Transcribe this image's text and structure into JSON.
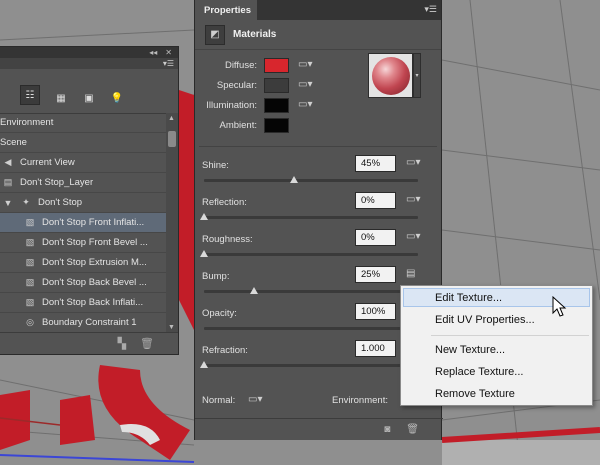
{
  "panel3d": {
    "items": [
      {
        "label": "Environment",
        "icon": "",
        "indent": 2,
        "selected": false
      },
      {
        "label": "Scene",
        "icon": "",
        "indent": 2,
        "selected": false
      },
      {
        "label": "Current View",
        "icon": "camera-icon",
        "indent": 0,
        "selected": false
      },
      {
        "label": "Don't Stop_Layer",
        "icon": "layer-icon",
        "indent": 0,
        "selected": false
      },
      {
        "label": "Don't Stop",
        "icon": "mesh-icon",
        "indent": 0,
        "selected": false
      },
      {
        "label": "Don't Stop Front Inflati...",
        "icon": "material-icon",
        "indent": 1,
        "selected": true
      },
      {
        "label": "Don't Stop Front Bevel ...",
        "icon": "material-icon",
        "indent": 1,
        "selected": false
      },
      {
        "label": "Don't Stop Extrusion M...",
        "icon": "material-icon",
        "indent": 1,
        "selected": false
      },
      {
        "label": "Don't Stop Back Bevel ...",
        "icon": "material-icon",
        "indent": 1,
        "selected": false
      },
      {
        "label": "Don't Stop Back Inflati...",
        "icon": "material-icon",
        "indent": 1,
        "selected": false
      },
      {
        "label": "Boundary Constraint 1",
        "icon": "constraint-icon",
        "indent": 1,
        "selected": false
      }
    ]
  },
  "properties": {
    "tab_label": "Properties",
    "section_title": "Materials",
    "swatches": [
      {
        "label": "Diffuse:",
        "color": "#d8262d"
      },
      {
        "label": "Specular:",
        "color": "#3c3c3c"
      },
      {
        "label": "Illumination:",
        "color": "#050505"
      },
      {
        "label": "Ambient:",
        "color": "#050505"
      }
    ],
    "params": [
      {
        "label": "Shine:",
        "value": "45%",
        "level": 0.45
      },
      {
        "label": "Reflection:",
        "value": "0%",
        "level": 0
      },
      {
        "label": "Roughness:",
        "value": "0%",
        "level": 0
      },
      {
        "label": "Bump:",
        "value": "25%",
        "level": 0.25
      },
      {
        "label": "Opacity:",
        "value": "100%",
        "level": 1
      },
      {
        "label": "Refraction:",
        "value": "1.000",
        "level": 0
      }
    ],
    "normal_label": "Normal:",
    "environment_label": "Environment:"
  },
  "context_menu": {
    "items": [
      "Edit Texture...",
      "Edit UV Properties...",
      "New Texture...",
      "Replace Texture...",
      "Remove Texture"
    ],
    "highlighted": 0
  }
}
